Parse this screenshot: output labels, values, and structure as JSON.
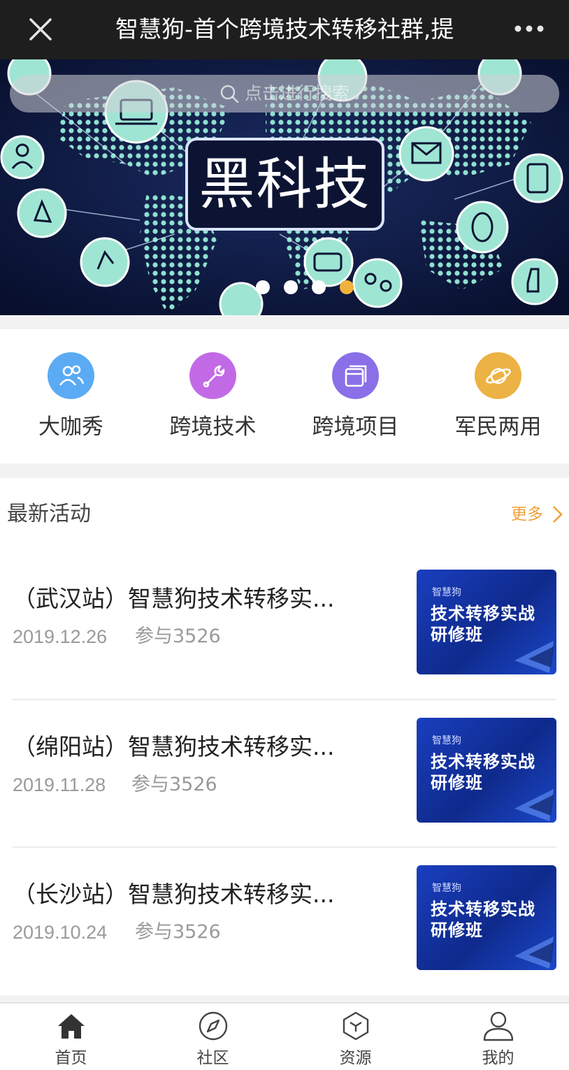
{
  "topbar": {
    "title": "智慧狗-首个跨境技术转移社群,提",
    "close_icon": "close-icon",
    "more_icon": "more-dots-icon"
  },
  "banner": {
    "search_placeholder": "点击进行搜索",
    "headline": "黑科技",
    "carousel_total": 4,
    "carousel_active": 4,
    "colors": {
      "background": "#0b1a40",
      "dot_active": "#f0b23c",
      "dot": "#ffffff"
    }
  },
  "categories": [
    {
      "label": "大咖秀",
      "icon": "people-icon",
      "color": "#5aabf3"
    },
    {
      "label": "跨境技术",
      "icon": "wrench-icon",
      "color": "#c26ae6"
    },
    {
      "label": "跨境项目",
      "icon": "stack-icon",
      "color": "#8a6fe8"
    },
    {
      "label": "军民两用",
      "icon": "planet-icon",
      "color": "#ecb243"
    }
  ],
  "activities": {
    "title": "最新活动",
    "more_label": "更多",
    "items": [
      {
        "name": "（武汉站）智慧狗技术转移实...",
        "date": "2019.12.26",
        "join": "参与3526",
        "thumb_brand": "智慧狗",
        "thumb_line1": "技术转移实战",
        "thumb_line2": "研修班"
      },
      {
        "name": "（绵阳站）智慧狗技术转移实...",
        "date": "2019.11.28",
        "join": "参与3526",
        "thumb_brand": "智慧狗",
        "thumb_line1": "技术转移实战",
        "thumb_line2": "研修班"
      },
      {
        "name": "（长沙站）智慧狗技术转移实...",
        "date": "2019.10.24",
        "join": "参与3526",
        "thumb_brand": "智慧狗",
        "thumb_line1": "技术转移实战",
        "thumb_line2": "研修班"
      }
    ]
  },
  "bottom_nav": [
    {
      "label": "首页",
      "icon": "home-icon",
      "active": true
    },
    {
      "label": "社区",
      "icon": "compass-icon",
      "active": false
    },
    {
      "label": "资源",
      "icon": "cube-icon",
      "active": false
    },
    {
      "label": "我的",
      "icon": "user-icon",
      "active": false
    }
  ]
}
